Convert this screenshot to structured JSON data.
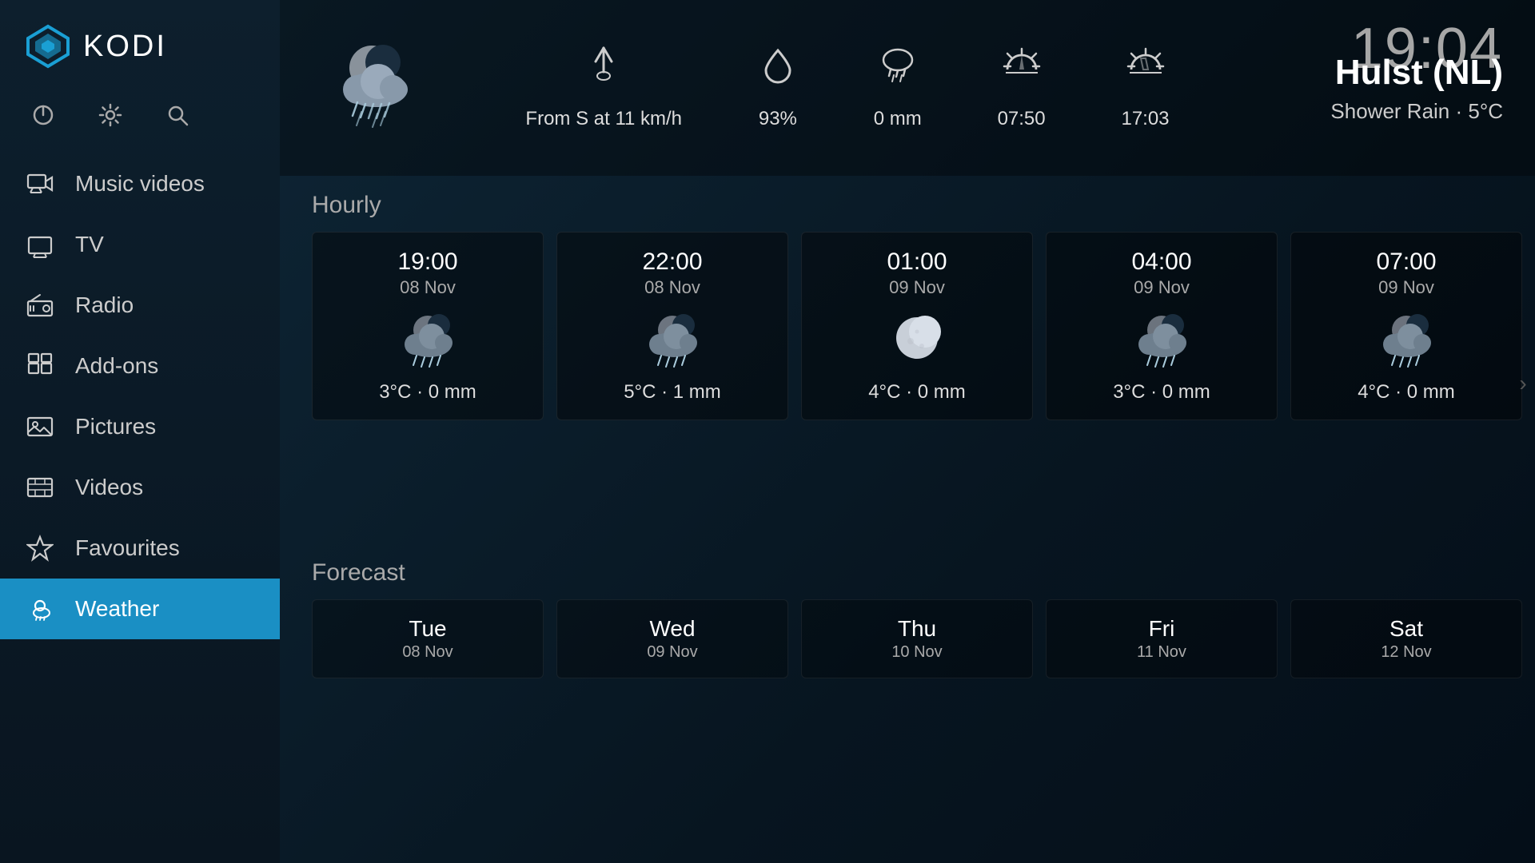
{
  "app": {
    "name": "KODI",
    "clock": "19:04"
  },
  "sidebar": {
    "top_buttons": [
      {
        "id": "power",
        "label": "⏻",
        "icon_name": "power-icon"
      },
      {
        "id": "settings",
        "label": "⚙",
        "icon_name": "settings-icon"
      },
      {
        "id": "search",
        "label": "🔍",
        "icon_name": "search-icon"
      }
    ],
    "nav_items": [
      {
        "id": "music-videos",
        "label": "Music videos",
        "icon": "🎬",
        "active": false
      },
      {
        "id": "tv",
        "label": "TV",
        "icon": "📺",
        "active": false
      },
      {
        "id": "radio",
        "label": "Radio",
        "icon": "📻",
        "active": false
      },
      {
        "id": "add-ons",
        "label": "Add-ons",
        "icon": "📦",
        "active": false
      },
      {
        "id": "pictures",
        "label": "Pictures",
        "icon": "🖼",
        "active": false
      },
      {
        "id": "videos",
        "label": "Videos",
        "icon": "🎞",
        "active": false
      },
      {
        "id": "favourites",
        "label": "Favourites",
        "icon": "⭐",
        "active": false
      },
      {
        "id": "weather",
        "label": "Weather",
        "icon": "🌦",
        "active": true
      }
    ]
  },
  "weather": {
    "location": "Hulst (NL)",
    "condition": "Shower Rain · 5°C",
    "wind": "From S at 11 km/h",
    "humidity": "93%",
    "precipitation": "0 mm",
    "sunrise": "07:50",
    "sunset": "17:03",
    "section_hourly": "Hourly",
    "section_forecast": "Forecast",
    "hourly": [
      {
        "time": "19:00",
        "date": "08 Nov",
        "temp": "3°C · 0 mm"
      },
      {
        "time": "22:00",
        "date": "08 Nov",
        "temp": "5°C · 1 mm"
      },
      {
        "time": "01:00",
        "date": "09 Nov",
        "temp": "4°C · 0 mm"
      },
      {
        "time": "04:00",
        "date": "09 Nov",
        "temp": "3°C · 0 mm"
      },
      {
        "time": "07:00",
        "date": "09 Nov",
        "temp": "4°C · 0 mm"
      }
    ],
    "forecast": [
      {
        "day": "Tue",
        "date": "08 Nov"
      },
      {
        "day": "Wed",
        "date": "09 Nov"
      },
      {
        "day": "Thu",
        "date": "10 Nov"
      },
      {
        "day": "Fri",
        "date": "11 Nov"
      },
      {
        "day": "Sat",
        "date": "12 Nov"
      }
    ]
  }
}
